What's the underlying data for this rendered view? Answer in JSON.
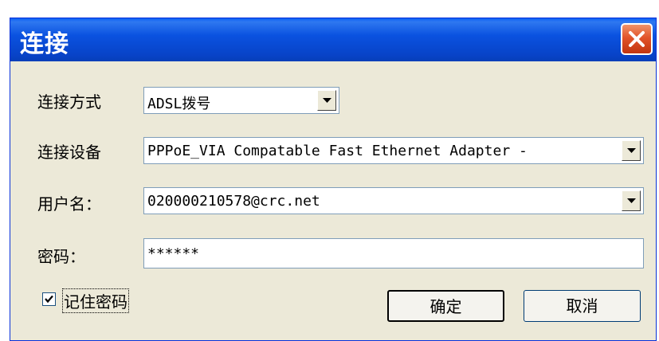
{
  "window": {
    "title": "连接"
  },
  "form": {
    "connection_method": {
      "label": "连接方式",
      "value": "ADSL拨号"
    },
    "connection_device": {
      "label": "连接设备",
      "value": "PPPoE_VIA Compatable Fast Ethernet Adapter -"
    },
    "username": {
      "label": "用户名：",
      "value": "020000210578@crc.net"
    },
    "password": {
      "label": "密码：",
      "value": "******"
    }
  },
  "remember_password": {
    "label": "记住密码",
    "checked": true
  },
  "buttons": {
    "ok_label": "确定",
    "cancel_label": "取消"
  },
  "icons": {
    "close": "close-icon",
    "dropdown": "chevron-down-icon",
    "check": "checkmark-icon"
  },
  "colors": {
    "titlebar": "#0a52e0",
    "close": "#e2542a",
    "dialog_bg": "#ece9d8"
  }
}
